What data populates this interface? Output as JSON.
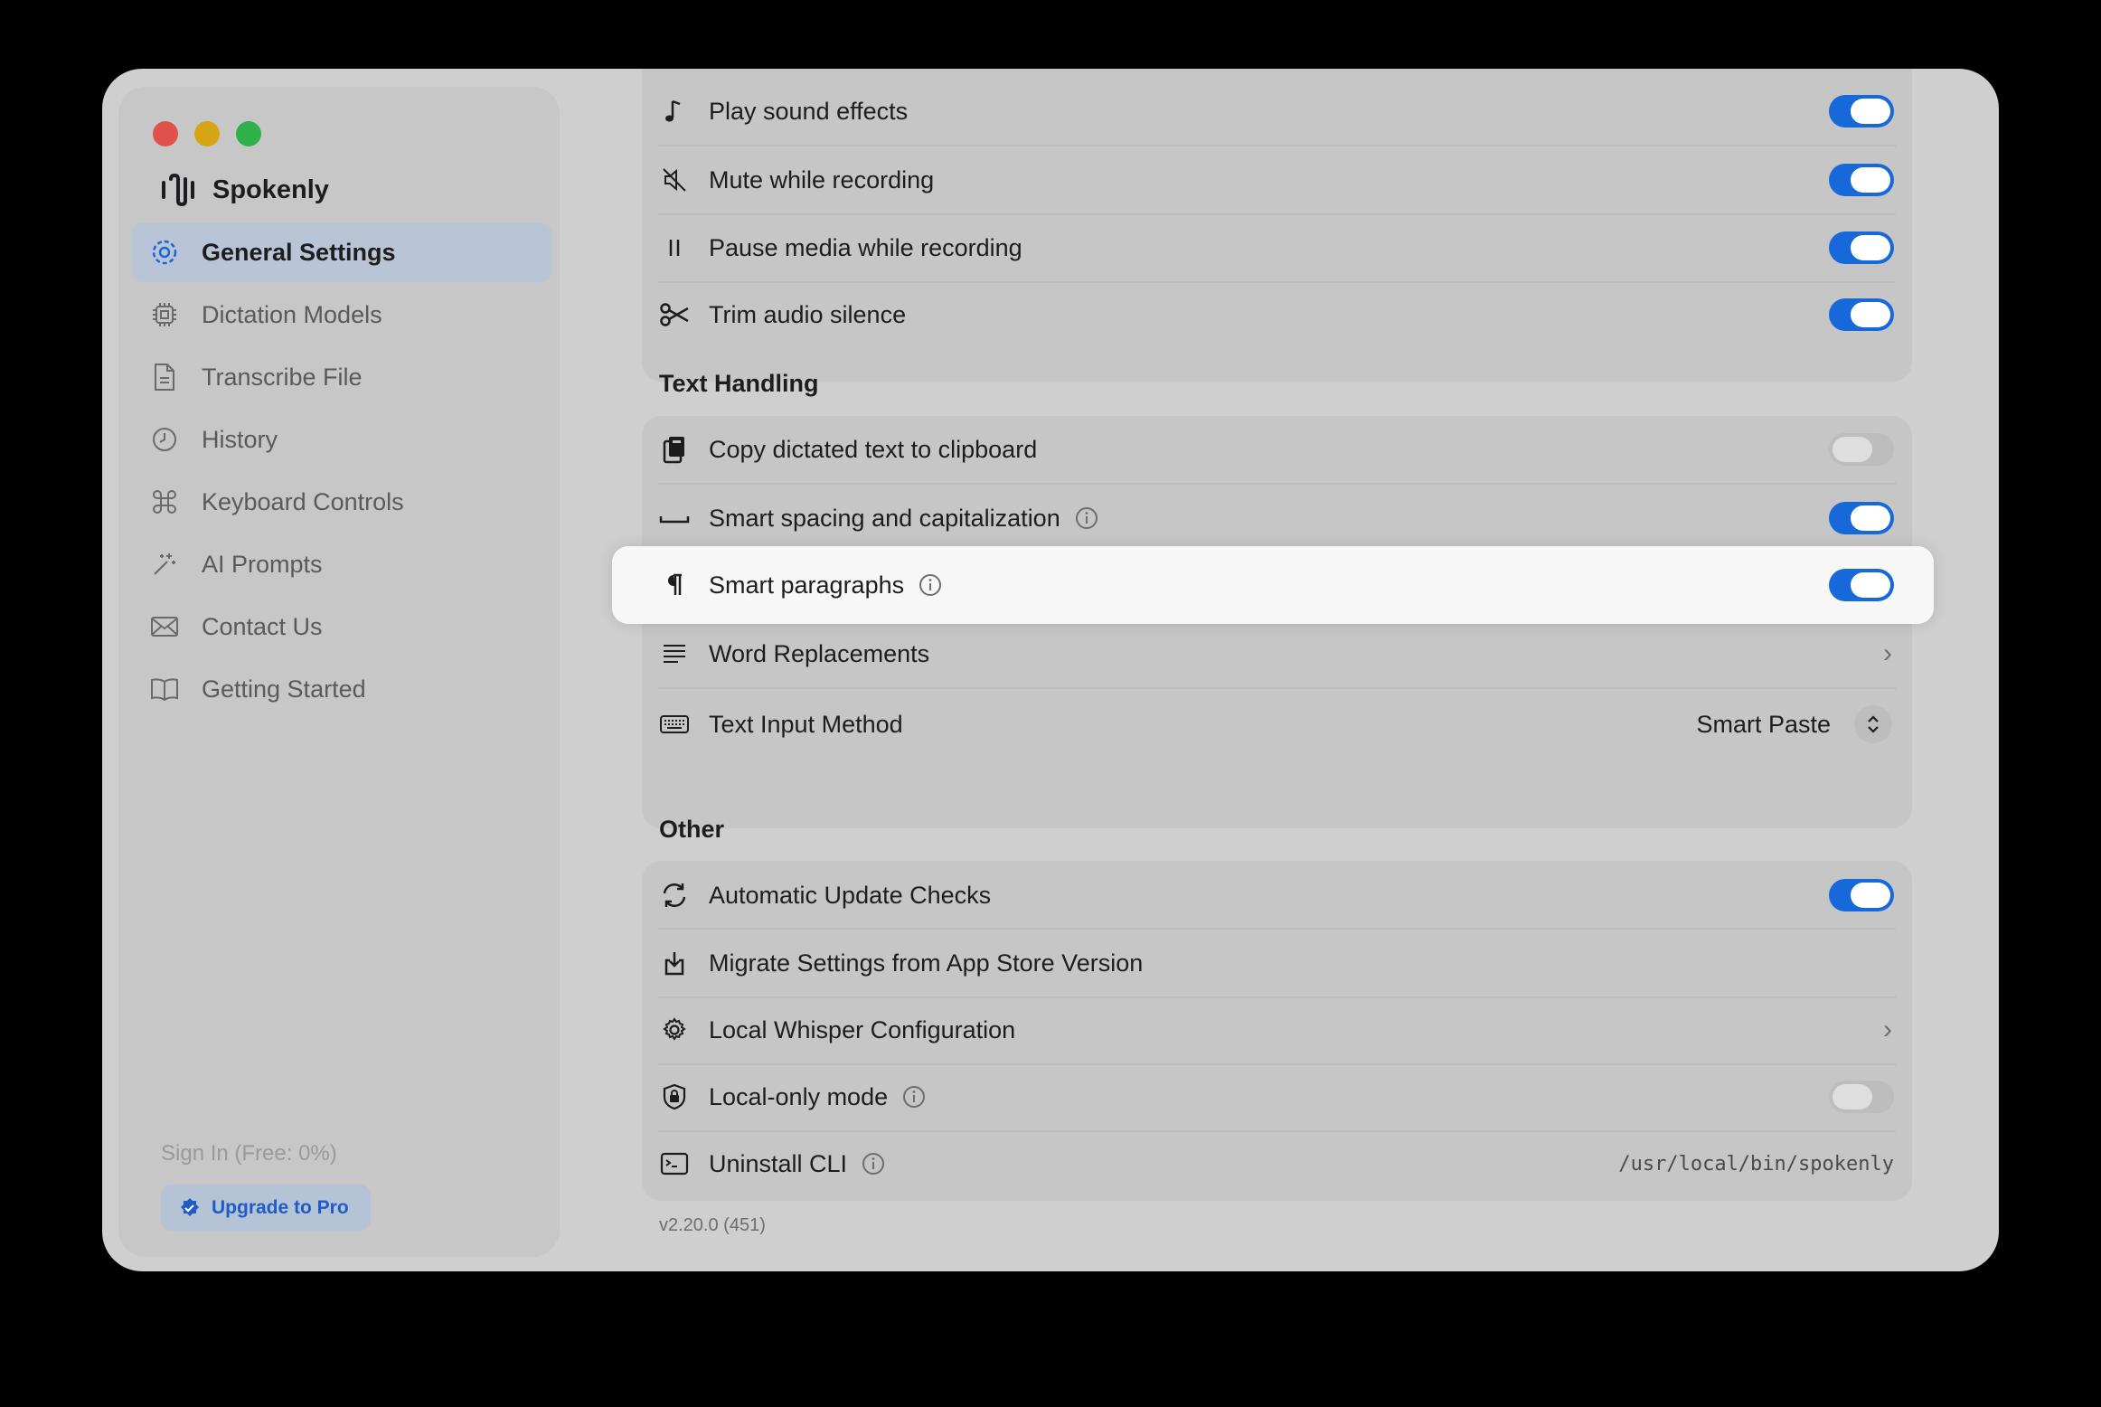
{
  "window": {
    "traffic_colors": [
      "#e0514c",
      "#d6a414",
      "#30b24a"
    ]
  },
  "sidebar": {
    "app_name": "Spokenly",
    "items": [
      {
        "label": "General Settings",
        "icon": "gear-icon",
        "active": true
      },
      {
        "label": "Dictation Models",
        "icon": "chip-icon"
      },
      {
        "label": "Transcribe File",
        "icon": "document-icon"
      },
      {
        "label": "History",
        "icon": "clock-icon"
      },
      {
        "label": "Keyboard Controls",
        "icon": "command-icon"
      },
      {
        "label": "AI Prompts",
        "icon": "sparkle-icon"
      },
      {
        "label": "Contact Us",
        "icon": "envelope-icon"
      },
      {
        "label": "Getting Started",
        "icon": "book-icon"
      }
    ],
    "sign_in": "Sign In (Free: 0%)",
    "upgrade": "Upgrade to Pro"
  },
  "audio": {
    "rows": [
      {
        "label": "Play sound effects",
        "icon": "music-note-icon",
        "on": true
      },
      {
        "label": "Mute while recording",
        "icon": "speaker-mute-icon",
        "on": true
      },
      {
        "label": "Pause media while recording",
        "icon": "pause-icon",
        "on": true
      },
      {
        "label": "Trim audio silence",
        "icon": "scissors-icon",
        "on": true
      }
    ]
  },
  "text_handling": {
    "title": "Text Handling",
    "copy": {
      "label": "Copy dictated text to clipboard",
      "on": false
    },
    "spacing": {
      "label": "Smart spacing and capitalization",
      "on": true
    },
    "paragraphs": {
      "label": "Smart paragraphs",
      "on": true
    },
    "replacements": {
      "label": "Word Replacements"
    },
    "input_method": {
      "label": "Text Input Method",
      "value": "Smart Paste"
    }
  },
  "other": {
    "title": "Other",
    "updates": {
      "label": "Automatic Update Checks",
      "on": true
    },
    "migrate": {
      "label": "Migrate Settings from App Store Version"
    },
    "whisper": {
      "label": "Local Whisper Configuration"
    },
    "local_only": {
      "label": "Local-only mode",
      "on": false
    },
    "cli": {
      "label": "Uninstall CLI",
      "path": "/usr/local/bin/spokenly"
    }
  },
  "version": "v2.20.0 (451)",
  "colors": {
    "accent": "#1769d9",
    "pro_text": "#1f5cc7"
  }
}
